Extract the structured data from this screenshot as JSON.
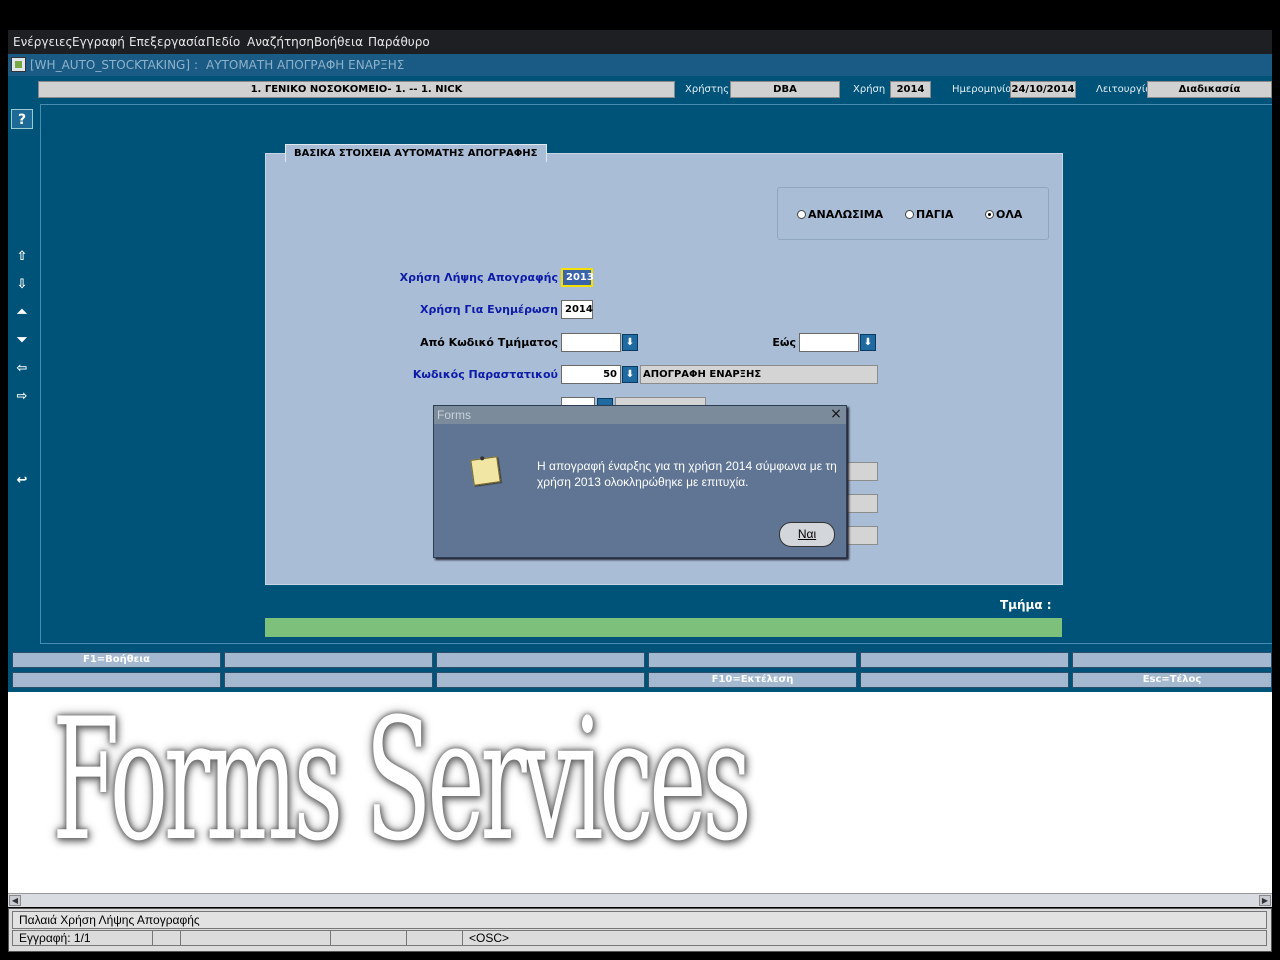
{
  "menu": [
    "Ενέργειες",
    "Εγγραφή",
    "Επεξεργασία",
    "Πεδίο",
    "Αναζήτηση",
    "Βοήθεια",
    "Παράθυρο"
  ],
  "window": {
    "form_code": "[WH_AUTO_STOCKTAKING]",
    "separator": ":",
    "title": "ΑΥΤΟΜΑΤΗ ΑΠΟΓΡΑΦΗ ΕΝΑΡΞΗΣ"
  },
  "header": {
    "organization": "1. ΓΕΝΙΚΟ ΝΟΣΟΚΟΜΕΙΟ- 1. -- 1. NICK",
    "user_label": "Χρήστης",
    "user": "DBA",
    "year_label": "Χρήση",
    "year": "2014",
    "date_label": "Ημερομηνία",
    "date": "24/10/2014",
    "function_label": "Λειτουργία",
    "function": "Διαδικασία"
  },
  "toolbar": {
    "help": "?",
    "first": "⇧",
    "last": "⇩",
    "prev": "⏶",
    "next": "⏷",
    "back": "⇦",
    "forward": "⇨",
    "undo": "↩"
  },
  "panel": {
    "tab_title": "ΒΑΣΙΚΑ ΣΤΟΙΧΕΙΑ ΑΥΤΟΜΑΤΗΣ ΑΠΟΓΡΑΦΗΣ",
    "radios": [
      {
        "label": "ΑΝΑΛΩΣΙΜΑ",
        "selected": false
      },
      {
        "label": "ΠΑΓΙΑ",
        "selected": false
      },
      {
        "label": "ΟΛΑ",
        "selected": true
      }
    ],
    "fields": {
      "source_year_label": "Χρήση Λήψης Απογραφής",
      "source_year": "2013",
      "target_year_label": "Χρήση Για Ενημέρωση",
      "target_year": "2014",
      "dept_from_label": "Από Κωδικό Τμήματος",
      "dept_from": "",
      "dept_to_label": "Εώς",
      "dept_to": "",
      "doc_code_label": "Κωδικός Παραστατικού",
      "doc_code": "50",
      "doc_desc": "ΑΠΟΓΡΑΦΗ ΕΝΑΡΞΗΣ",
      "lov_symbol": "⬇"
    },
    "tmima_label": "Τμήμα :"
  },
  "fkeys": {
    "row1": [
      "F1=Βοήθεια",
      "",
      "",
      "",
      "",
      ""
    ],
    "row2": [
      "",
      "",
      "",
      "F10=Εκτέλεση",
      "",
      "Esc=Τέλος"
    ]
  },
  "watermark": "Forms Services",
  "dialog": {
    "title": "Forms",
    "close": "×",
    "message": "Η απογραφή έναρξης για τη χρήση 2014 σύμφωνα με τη χρήση 2013 ολοκληρώθηκε με επιτυχία.",
    "ok_label": "Ναι"
  },
  "status": {
    "message": "Παλαιά Χρήση Λήψης Απογραφής",
    "record": "Εγγραφή: 1/1",
    "mode": "<OSC>"
  }
}
